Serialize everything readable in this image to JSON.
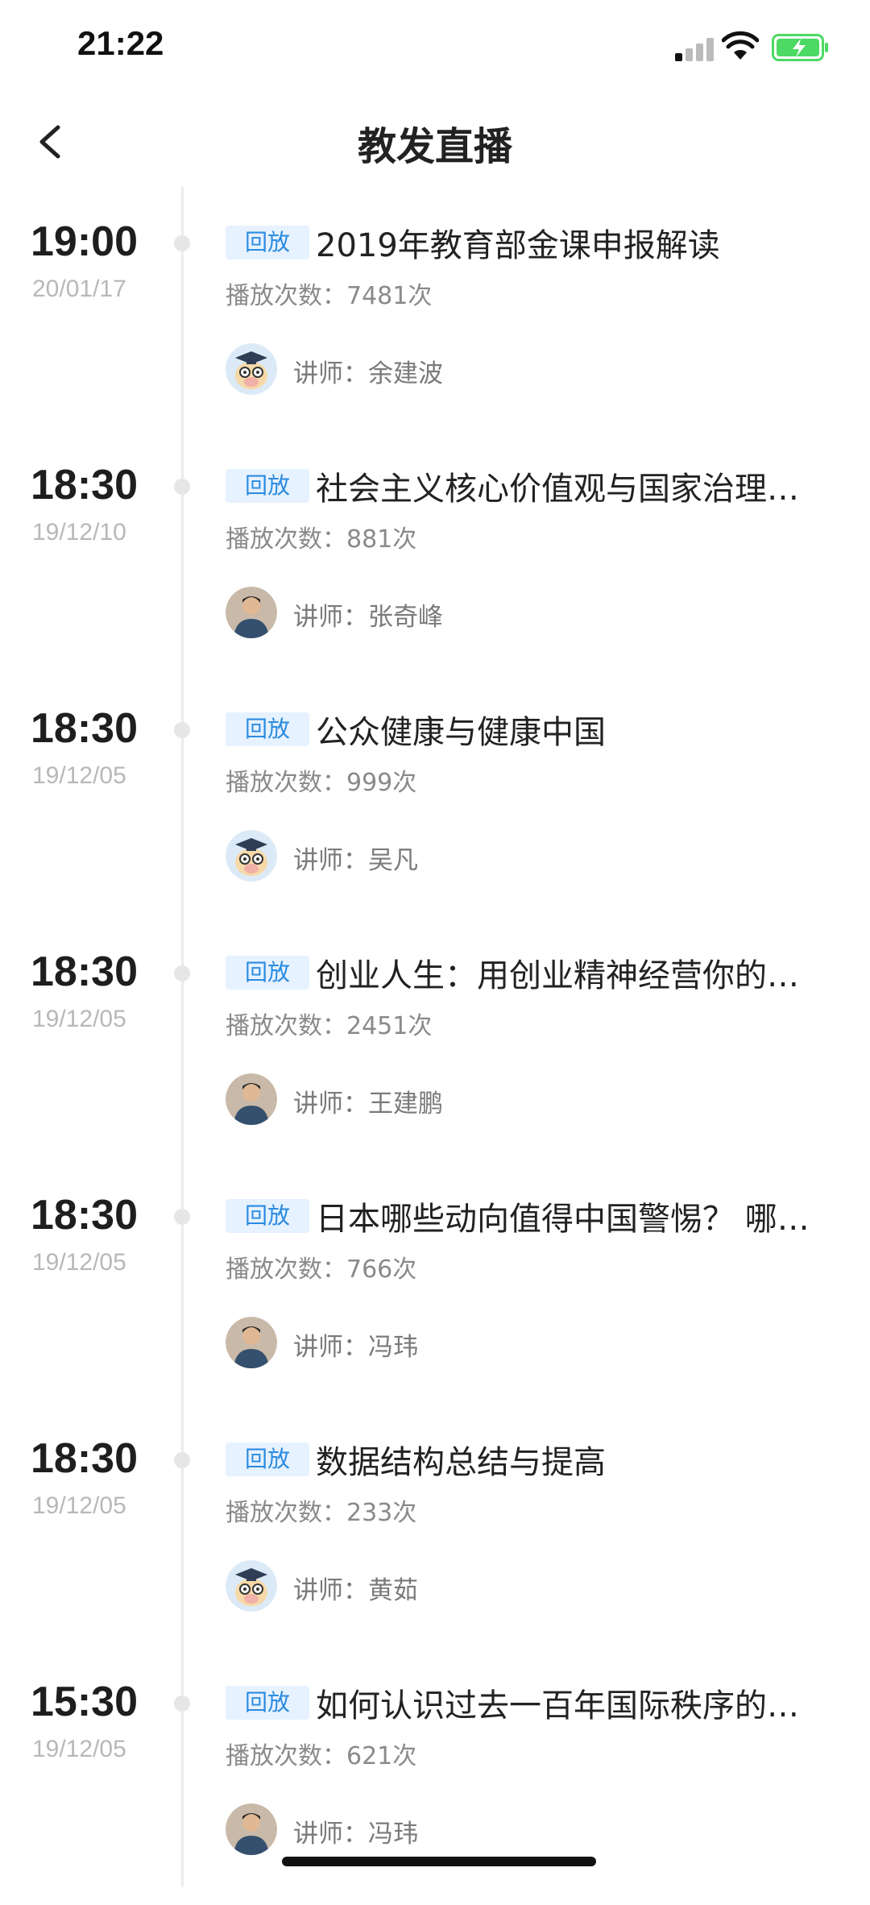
{
  "status_bar": {
    "time": "21:22"
  },
  "nav": {
    "title": "教发直播"
  },
  "colors": {
    "accent": "#2b8be0",
    "badge_bg": "#e6f2ff",
    "battery_green": "#4cd964"
  },
  "items": [
    {
      "time": "19:00",
      "date": "20/01/17",
      "badge": "回放",
      "title": "2019年教育部金课申报解读",
      "plays_label": "播放次数：",
      "plays": "7481次",
      "lecturer": "讲师：余建波",
      "avatar": "cartoon-mascot-icon"
    },
    {
      "time": "18:30",
      "date": "19/12/10",
      "badge": "回放",
      "title": "社会主义核心价值观与国家治理…",
      "plays_label": "播放次数：",
      "plays": "881次",
      "lecturer": "讲师：张奇峰",
      "avatar": "person-photo"
    },
    {
      "time": "18:30",
      "date": "19/12/05",
      "badge": "回放",
      "title": "公众健康与健康中国",
      "plays_label": "播放次数：",
      "plays": "999次",
      "lecturer": "讲师：吴凡",
      "avatar": "cartoon-mascot-icon"
    },
    {
      "time": "18:30",
      "date": "19/12/05",
      "badge": "回放",
      "title": "创业人生：用创业精神经营你的…",
      "plays_label": "播放次数：",
      "plays": "2451次",
      "lecturer": "讲师：王建鹏",
      "avatar": "person-photo"
    },
    {
      "time": "18:30",
      "date": "19/12/05",
      "badge": "回放",
      "title": "日本哪些动向值得中国警惕？ 哪…",
      "plays_label": "播放次数：",
      "plays": "766次",
      "lecturer": "讲师：冯玮",
      "avatar": "person-photo"
    },
    {
      "time": "18:30",
      "date": "19/12/05",
      "badge": "回放",
      "title": "数据结构总结与提高",
      "plays_label": "播放次数：",
      "plays": "233次",
      "lecturer": "讲师：黄茹",
      "avatar": "cartoon-mascot-icon"
    },
    {
      "time": "15:30",
      "date": "19/12/05",
      "badge": "回放",
      "title": "如何认识过去一百年国际秩序的…",
      "plays_label": "播放次数：",
      "plays": "621次",
      "lecturer": "讲师：冯玮",
      "avatar": "person-photo"
    }
  ]
}
